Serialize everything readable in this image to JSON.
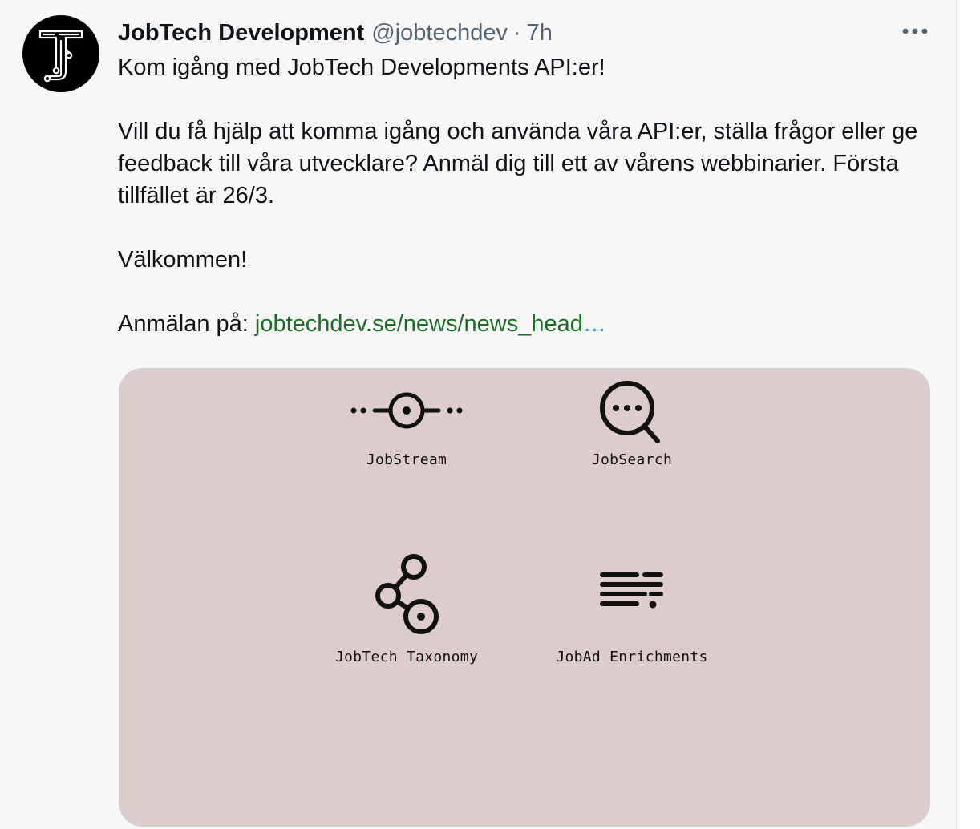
{
  "tweet": {
    "display_name": "JobTech Development",
    "handle": "@jobtechdev",
    "separator": "·",
    "timestamp": "7h",
    "more_icon": "more-horizontal-icon",
    "avatar_icon": "jobtech-logo-icon",
    "text": {
      "line1": "Kom igång med JobTech Developments API:er!",
      "para2": "Vill du få hjälp att komma igång och använda våra API:er, ställa frågor eller ge feedback till våra utvecklare? Anmäl dig till ett av vårens webbinarier. Första tillfället är 26/3.",
      "para3": "Välkommen!",
      "signup_prefix": "Anmälan på: ",
      "link_text": "jobtechdev.se/news/news_head",
      "link_ellipsis": "…"
    }
  },
  "card": {
    "background_color": "#decccd",
    "products": [
      {
        "label": "JobStream",
        "icon": "jobstream-icon"
      },
      {
        "label": "JobSearch",
        "icon": "search-icon"
      },
      {
        "label": "JobTech Taxonomy",
        "icon": "taxonomy-nodes-icon"
      },
      {
        "label": "JobAd Enrichments",
        "icon": "text-lines-icon"
      }
    ]
  },
  "colors": {
    "link": "#1e6b2a",
    "ellipsis": "#1d9bf0",
    "secondary_text": "#536471"
  }
}
